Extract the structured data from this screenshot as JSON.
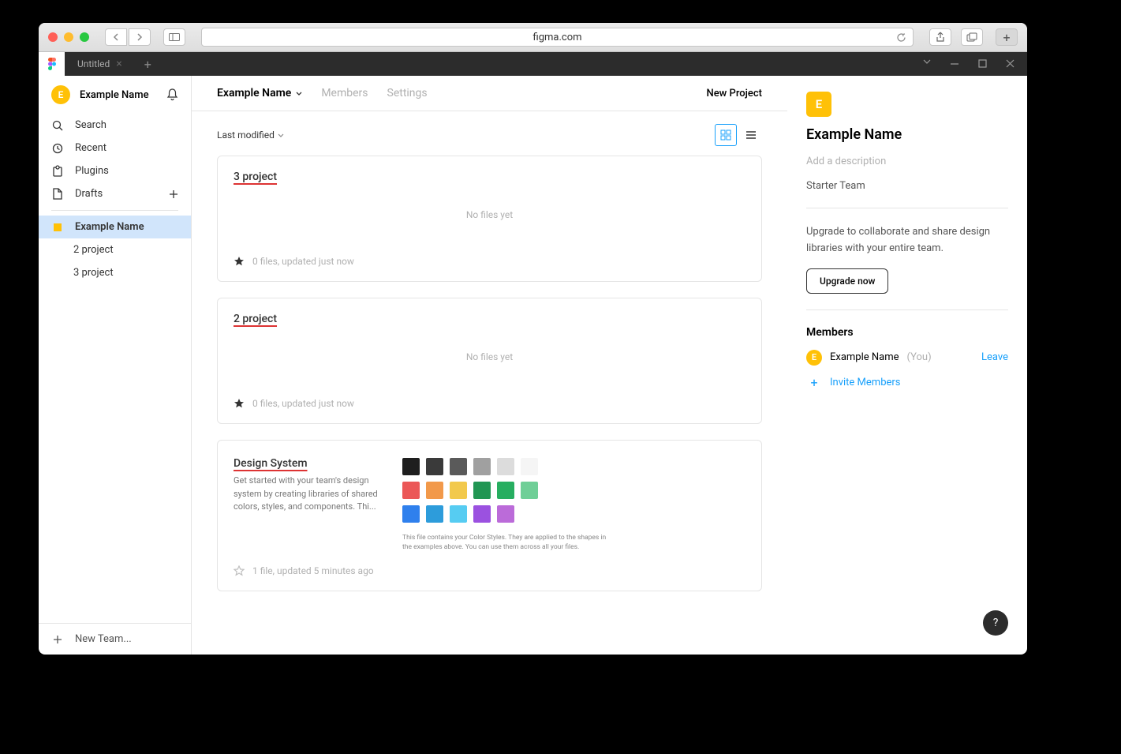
{
  "browser": {
    "url": "figma.com"
  },
  "app_tab": {
    "title": "Untitled"
  },
  "sidebar": {
    "user_initial": "E",
    "user_name": "Example Name",
    "search": "Search",
    "recent": "Recent",
    "plugins": "Plugins",
    "drafts": "Drafts",
    "team_name": "Example Name",
    "project_2": "2 project",
    "project_3": "3 project",
    "new_team": "New Team..."
  },
  "header": {
    "team_name": "Example Name",
    "members": "Members",
    "settings": "Settings",
    "new_project": "New Project"
  },
  "toolbar": {
    "sort": "Last modified"
  },
  "projects": {
    "p3": {
      "title": "3 project",
      "empty": "No files yet",
      "meta": "0 files, updated just now"
    },
    "p2": {
      "title": "2 project",
      "empty": "No files yet",
      "meta": "0 files, updated just now"
    },
    "ds": {
      "title": "Design System",
      "desc": "Get started with your team's design system by creating libraries of shared colors, styles, and components. Thi...",
      "meta": "1 file, updated 5 minutes ago",
      "caption": "This file contains your Color Styles. They are applied to the shapes in the examples above. You can use them across all your files.",
      "swatches": {
        "r1": [
          "#1e1e1e",
          "#3a3a3a",
          "#5a5a5a",
          "#a0a0a0",
          "#dcdcdc",
          "#f5f5f5"
        ],
        "r2": [
          "#eb5757",
          "#f2994a",
          "#f2c94c",
          "#219653",
          "#27ae60",
          "#6fcf97"
        ],
        "r3": [
          "#2f80ed",
          "#2d9cdb",
          "#56ccf2",
          "#9b51e0",
          "#bb6bd9"
        ]
      }
    }
  },
  "detail": {
    "initial": "E",
    "title": "Example Name",
    "desc_placeholder": "Add a description",
    "badge": "Starter Team",
    "upgrade_text": "Upgrade to collaborate and share design libraries with your entire team.",
    "upgrade_btn": "Upgrade now",
    "members_title": "Members",
    "member_initial": "E",
    "member_name": "Example Name",
    "member_you": "(You)",
    "leave": "Leave",
    "invite": "Invite Members"
  },
  "help": "?"
}
